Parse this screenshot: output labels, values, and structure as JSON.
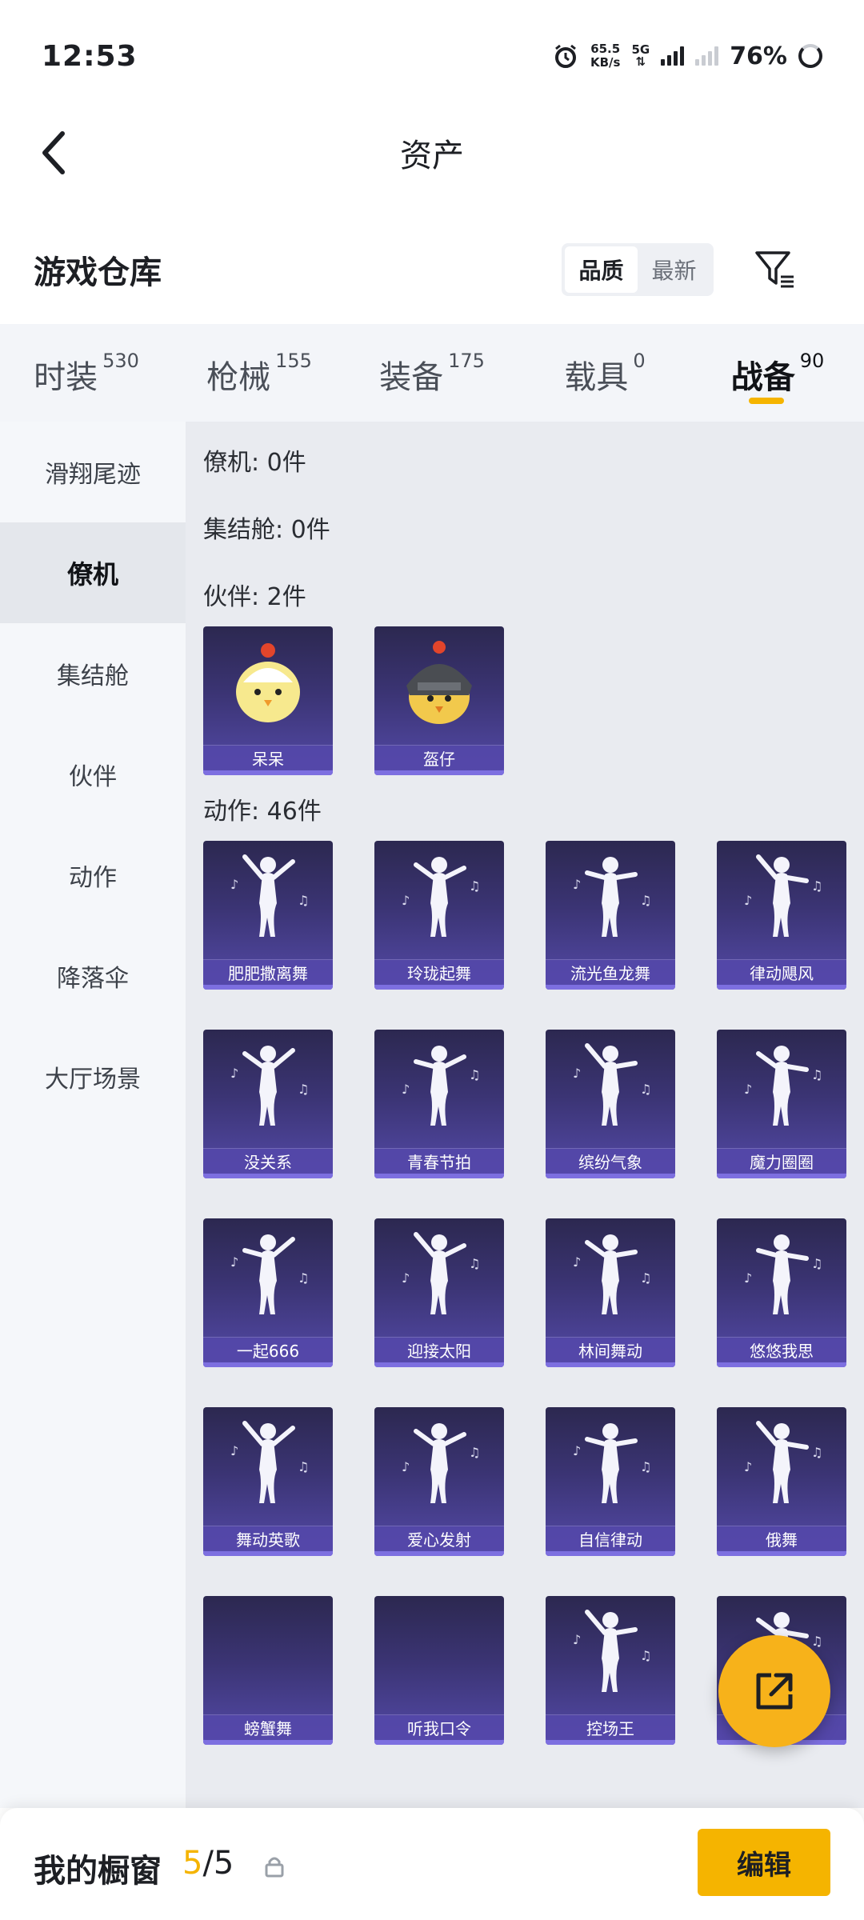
{
  "status_bar": {
    "time": "12:53",
    "speed_value": "65.5",
    "speed_unit": "KB/s",
    "network": "5G",
    "battery": "76%"
  },
  "header": {
    "title": "资产"
  },
  "warehouse": {
    "title": "游戏仓库",
    "sort_options": [
      "品质",
      "最新"
    ],
    "sort_selected": "品质"
  },
  "tabs": [
    {
      "label": "时装",
      "count": "530"
    },
    {
      "label": "枪械",
      "count": "155"
    },
    {
      "label": "装备",
      "count": "175"
    },
    {
      "label": "载具",
      "count": "0"
    },
    {
      "label": "战备",
      "count": "90"
    }
  ],
  "active_tab": "战备",
  "subnav": [
    "滑翔尾迹",
    "僚机",
    "集结舱",
    "伙伴",
    "动作",
    "降落伞",
    "大厅场景"
  ],
  "active_subnav": "僚机",
  "sections": {
    "wingman": "僚机: 0件",
    "capsule": "集结舱: 0件",
    "partner": "伙伴: 2件",
    "emote": "动作: 46件"
  },
  "partners": [
    "呆呆",
    "盔仔"
  ],
  "emotes": [
    "肥肥撒离舞",
    "玲珑起舞",
    "流光鱼龙舞",
    "律动飓风",
    "没关系",
    "青春节拍",
    "缤纷气象",
    "魔力圈圈",
    "一起666",
    "迎接太阳",
    "林间舞动",
    "悠悠我思",
    "舞动英歌",
    "爱心发射",
    "自信律动",
    "俄舞",
    "螃蟹舞",
    "听我口令",
    "控场王",
    ""
  ],
  "bottom_bar": {
    "label": "我的橱窗",
    "current": "5",
    "total": "/5",
    "edit_label": "编辑"
  },
  "colors": {
    "accent": "#f5b400",
    "card_top": "#2c2850",
    "card_bottom": "#544aa8"
  }
}
